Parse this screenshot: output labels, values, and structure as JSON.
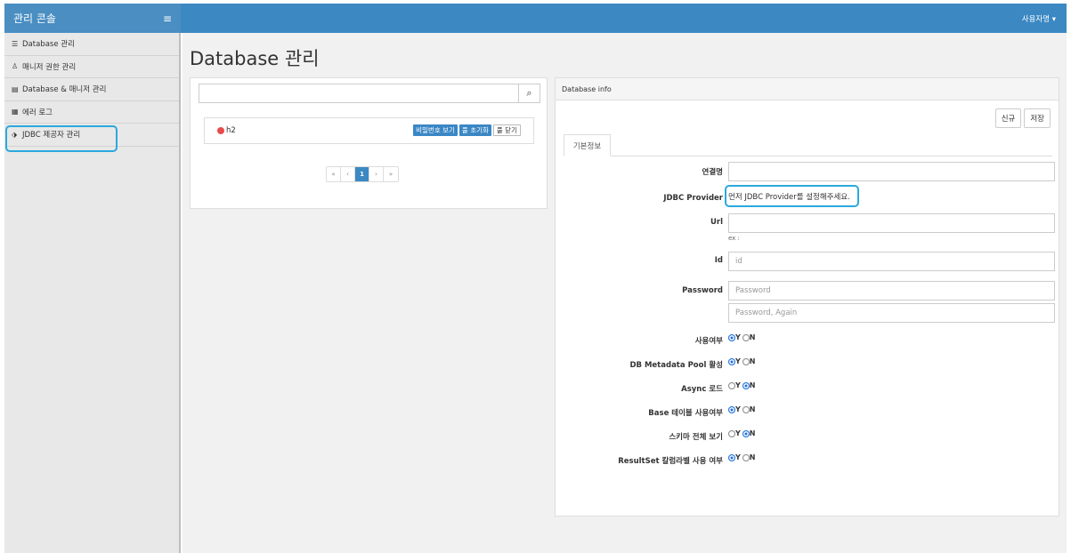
{
  "app": {
    "brand_title": "관리 콘솔",
    "menu_icon": "hamburger-icon",
    "user_label": "사용자명 ▾"
  },
  "sidebar": {
    "items": [
      {
        "icon": "database-icon",
        "label": "Database 관리"
      },
      {
        "icon": "user-lock-icon",
        "label": "매니저 권한 관리"
      },
      {
        "icon": "id-card-icon",
        "label": "Database & 매니저 관리"
      },
      {
        "icon": "list-icon",
        "label": "에러 로그"
      },
      {
        "icon": "plug-icon",
        "label": "JDBC 제공자 관리"
      }
    ]
  },
  "main": {
    "page_title": "Database 관리",
    "search": {
      "placeholder": "",
      "icon": "search-icon"
    },
    "db_list": [
      {
        "name": "h2",
        "status_color": "#e84b4b",
        "buttons": [
          "비밀번호 보기",
          "풀 초기화",
          "풀 닫기"
        ]
      }
    ],
    "pager": [
      "«",
      "‹",
      "1",
      "›",
      "»"
    ],
    "info_panel": {
      "heading": "Database info",
      "new_label": "신규",
      "save_label": "저장",
      "tab_label": "기본정보",
      "fields": {
        "conn_name_label": "연결명",
        "jdbc_provider_label": "JDBC Provider",
        "jdbc_provider_msg": "먼저 JDBC Provider를 설정해주세요.",
        "url_label": "Url",
        "url_ex": "ex :",
        "id_label": "Id",
        "id_placeholder": "id",
        "password_label": "Password",
        "password_placeholder": "Password",
        "password_again_placeholder": "Password, Again"
      },
      "radios": [
        {
          "label": "사용여부",
          "selected": "Y"
        },
        {
          "label": "DB Metadata Pool 활성",
          "selected": "Y"
        },
        {
          "label": "Async 로드",
          "selected": "N"
        },
        {
          "label": "Base 테이블 사용여부",
          "selected": "Y"
        },
        {
          "label": "스키마 전체 보기",
          "selected": "N"
        },
        {
          "label": "ResultSet 칼럼라벨 사용 여부",
          "selected": "Y"
        }
      ],
      "radio_y": "Y",
      "radio_n": "N"
    }
  }
}
